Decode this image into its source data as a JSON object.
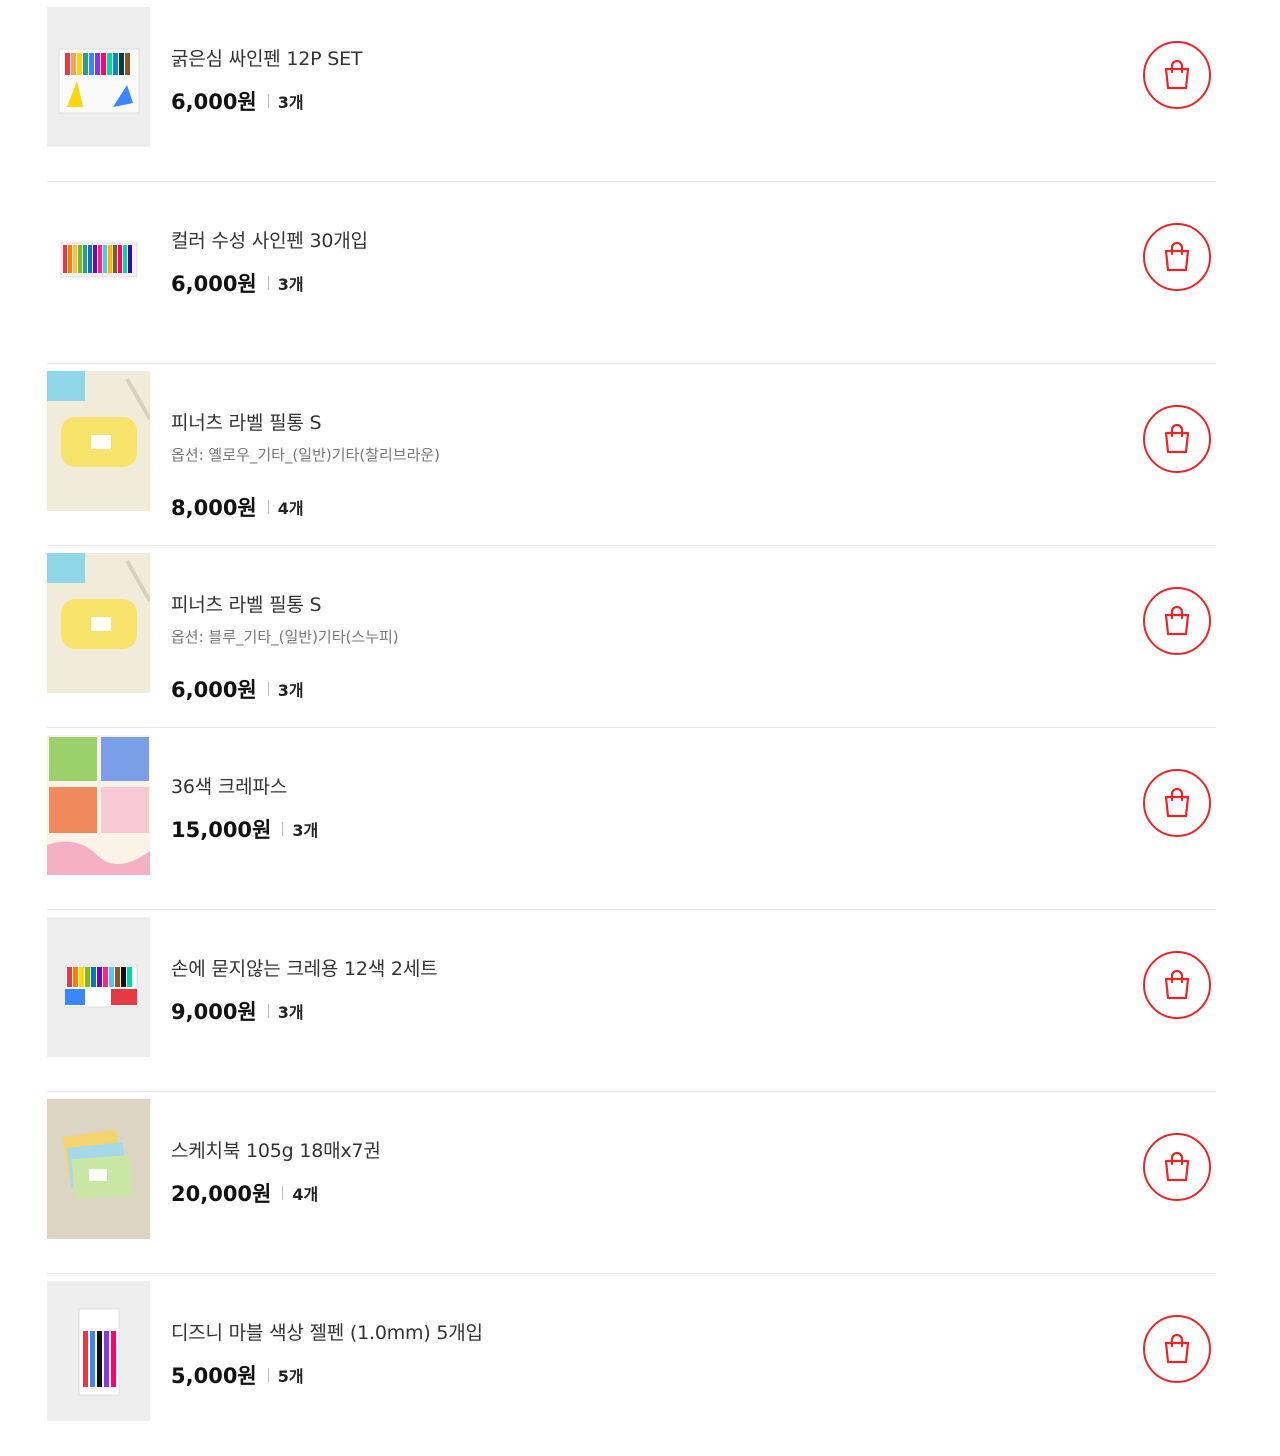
{
  "accent_color": "#e8262a",
  "items": [
    {
      "name": "굵은심 싸인펜 12P SET",
      "option": "",
      "price": "6,000원",
      "qty": "3개",
      "thumb": "marker-set-12-image"
    },
    {
      "name": "컬러 수성 사인펜 30개입",
      "option": "",
      "price": "6,000원",
      "qty": "3개",
      "thumb": "marker-set-30-image"
    },
    {
      "name": "피너츠 라벨 필통 S",
      "option": "옵션: 옐로우_기타_(일반)기타(찰리브라운)",
      "price": "8,000원",
      "qty": "4개",
      "thumb": "pencil-case-yellow-image"
    },
    {
      "name": "피너츠 라벨 필통 S",
      "option": "옵션: 블루_기타_(일반)기타(스누피)",
      "price": "6,000원",
      "qty": "3개",
      "thumb": "pencil-case-blue-image"
    },
    {
      "name": "36색 크레파스",
      "option": "",
      "price": "15,000원",
      "qty": "3개",
      "thumb": "crayon-36-image"
    },
    {
      "name": "손에 묻지않는 크레용 12색 2세트",
      "option": "",
      "price": "9,000원",
      "qty": "3개",
      "thumb": "crayon-12-image"
    },
    {
      "name": "스케치북 105g 18매x7권",
      "option": "",
      "price": "20,000원",
      "qty": "4개",
      "thumb": "sketchbook-image"
    },
    {
      "name": "디즈니 마블 색상 젤펜 (1.0mm) 5개입",
      "option": "",
      "price": "5,000원",
      "qty": "5개",
      "thumb": "gel-pen-image"
    }
  ]
}
